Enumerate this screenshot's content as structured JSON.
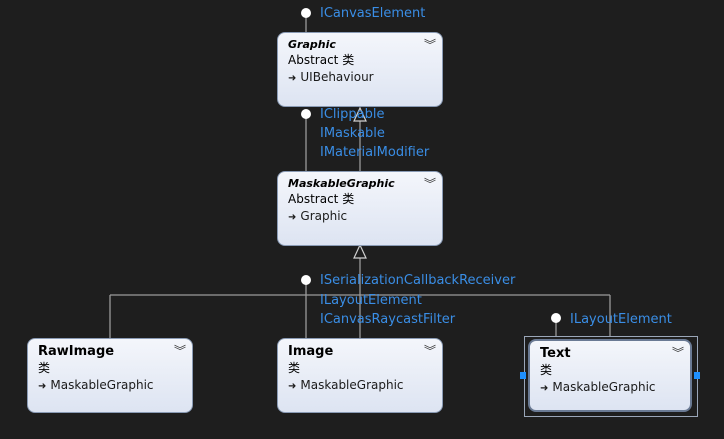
{
  "diagram": {
    "classes": [
      {
        "id": "graphic",
        "name": "Graphic",
        "stereotype": "Abstract 类",
        "base": "UIBehaviour",
        "italic": true
      },
      {
        "id": "maskable",
        "name": "MaskableGraphic",
        "stereotype": "Abstract 类",
        "base": "Graphic",
        "italic": true
      },
      {
        "id": "rawimage",
        "name": "RawImage",
        "stereotype": "类",
        "base": "MaskableGraphic",
        "italic": false
      },
      {
        "id": "image",
        "name": "Image",
        "stereotype": "类",
        "base": "MaskableGraphic",
        "italic": false
      },
      {
        "id": "text",
        "name": "Text",
        "stereotype": "类",
        "base": "MaskableGraphic",
        "italic": false,
        "selected": true
      }
    ],
    "interfaces": {
      "graphic_top": [
        "ICanvasElement"
      ],
      "graphic_bottom": [
        "IClippable",
        "IMaskable",
        "IMaterialModifier"
      ],
      "maskable_bottom": [
        "ISerializationCallbackReceiver",
        "ILayoutElement",
        "ICanvasRaycastFilter"
      ],
      "text_top": [
        "ILayoutElement"
      ]
    },
    "colors": {
      "background": "#1e1e1e",
      "interface_text": "#3a8ee6",
      "line": "#b0b0b0",
      "selection_handle": "#1e90ff"
    },
    "icons": {
      "collapse": "double-chevron-down-icon",
      "inherit": "inheritance-arrow-icon",
      "interface": "lollipop-icon"
    }
  }
}
